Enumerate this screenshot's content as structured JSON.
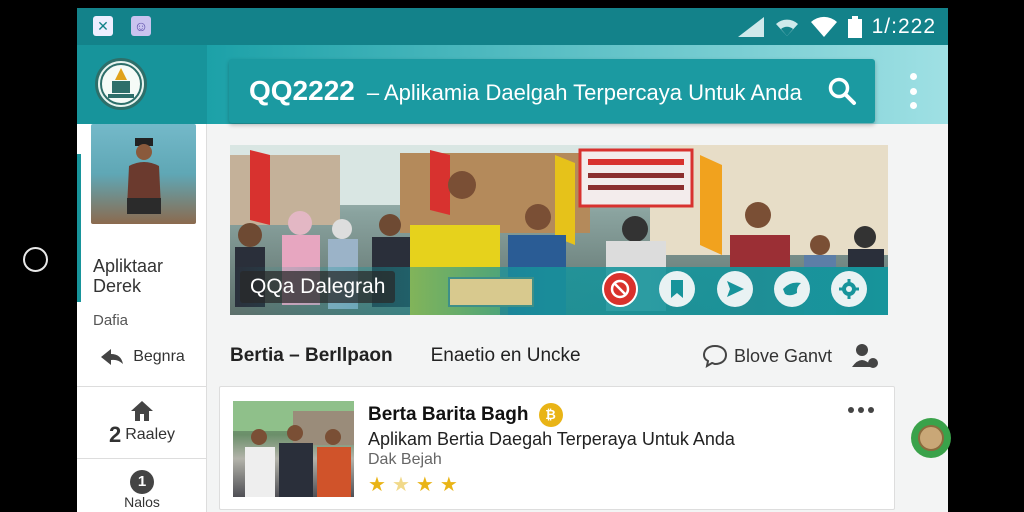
{
  "status_bar": {
    "time": "1/:222",
    "left_icons": [
      "x-box-icon",
      "person-badge-icon"
    ],
    "right_icons": [
      "signal-icon",
      "wifi-icon",
      "wifi-alt-icon",
      "battery-icon"
    ]
  },
  "app_bar": {
    "logo_text": "",
    "title_bold": "QQ2222",
    "title_rest": "– Aplikamia Daelgah Terpercaya Untuk Anda",
    "search_icon": "search-icon",
    "more_icon": "more-vert-icon"
  },
  "sidebar": {
    "title": "Apliktaar",
    "title_line2": "Derek",
    "subtitle": "Dafia",
    "items": [
      {
        "label": "Begnra",
        "icon": "share-icon"
      },
      {
        "label": "Raaley",
        "icon": "home-icon",
        "prefix": "2"
      },
      {
        "label": "Nalos",
        "icon": "info-icon",
        "prefix": "1"
      }
    ]
  },
  "banner": {
    "caption": "QQa Dalegrah",
    "sign_text": "BAAS 8 BAAS JA 3 DAM S NAAS",
    "buttons": [
      "block-icon",
      "bookmark-icon",
      "send-icon",
      "bird-icon",
      "gear-icon"
    ]
  },
  "tabs": {
    "active": "Bertia – Berllpaon",
    "second": "Enaetio en Uncke",
    "right": "Blove Ganvt",
    "right_icon": "chat-bubble-icon",
    "profile_icon": "user-settings-icon"
  },
  "card": {
    "title": "Berta Barita Bagh",
    "title_icon": "coin-icon",
    "description": "Aplikam Bertia Daegah Terperaya Untuk Anda",
    "subtitle": "Dak Bejah",
    "rating": 4,
    "more_icon": "more-horiz-icon"
  },
  "colors": {
    "accent": "#17949b",
    "status_bar": "#13828a",
    "star": "#e9b416",
    "fab": "#3aa24a"
  }
}
